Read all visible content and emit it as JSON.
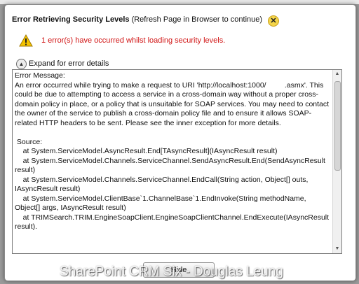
{
  "dialog": {
    "title_bold": "Error Retrieving Security Levels",
    "title_note": "(Refresh Page in Browser to continue)",
    "close_glyph": "✕",
    "error_summary": "1 error(s) have occurred whilst loading security levels.",
    "expand_label": "Expand for error details",
    "expand_glyph": "▲",
    "details_text": "Error Message:\nAn error occurred while trying to make a request to URI 'http://localhost:1000/         .asmx'. This could be due to attempting to access a service in a cross-domain way without a proper cross-domain policy in place, or a policy that is unsuitable for SOAP services. You may need to contact the owner of the service to publish a cross-domain policy file and to ensure it allows SOAP-related HTTP headers to be sent. Please see the inner exception for more details.\n\n Source:\n    at System.ServiceModel.AsyncResult.End[TAsyncResult](IAsyncResult result)\n    at System.ServiceModel.Channels.ServiceChannel.SendAsyncResult.End(SendAsyncResult result)\n    at System.ServiceModel.Channels.ServiceChannel.EndCall(String action, Object[] outs, IAsyncResult result)\n    at System.ServiceModel.ClientBase`1.ChannelBase`1.EndInvoke(String methodName, Object[] args, IAsyncResult result)\n    at TRIMSearch.TRIM.EngineSoapClient.EngineSoapClientChannel.EndExecute(IAsyncResult result).",
    "scroll_up_glyph": "▲",
    "scroll_down_glyph": "▼",
    "hide_label": "Hide"
  },
  "watermark": "SharePoint CRM Six - Douglas Leung",
  "colors": {
    "error_text": "#d11414",
    "warning_icon": "#f2c200"
  },
  "icons": [
    "close-icon",
    "warning-icon",
    "expand-collapse-icon"
  ]
}
